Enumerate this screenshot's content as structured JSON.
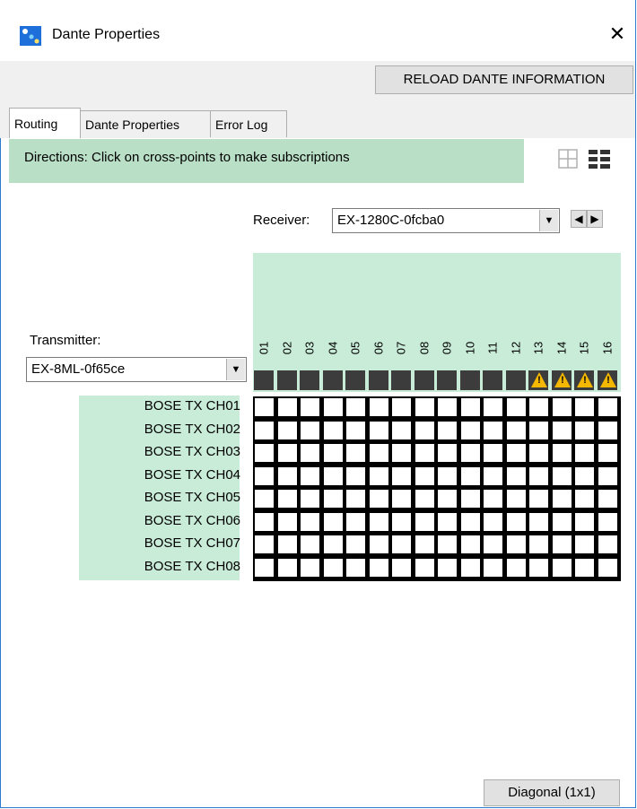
{
  "window": {
    "title": "Dante Properties",
    "close_glyph": "✕"
  },
  "toolbar": {
    "reload_label": "RELOAD DANTE INFORMATION"
  },
  "tabs": [
    {
      "label": "Routing",
      "active": true
    },
    {
      "label": "Dante Properties",
      "active": false
    },
    {
      "label": "Error Log",
      "active": false
    }
  ],
  "routing": {
    "directions": "Directions: Click on cross-points to make subscriptions",
    "view_icons": [
      "grid-view-icon",
      "list-view-icon"
    ],
    "receiver_label": "Receiver:",
    "receiver_value": "EX-1280C-0fcba0",
    "transmitter_label": "Transmitter:",
    "transmitter_value": "EX-8ML-0f65ce",
    "receiver_channels": [
      "01",
      "02",
      "03",
      "04",
      "05",
      "06",
      "07",
      "08",
      "09",
      "10",
      "11",
      "12",
      "13",
      "14",
      "15",
      "16"
    ],
    "channel_warnings": [
      false,
      false,
      false,
      false,
      false,
      false,
      false,
      false,
      false,
      false,
      false,
      false,
      true,
      true,
      true,
      true
    ],
    "transmitter_channels": [
      "BOSE TX CH01",
      "BOSE TX CH02",
      "BOSE TX CH03",
      "BOSE TX CH04",
      "BOSE TX CH05",
      "BOSE TX CH06",
      "BOSE TX CH07",
      "BOSE TX CH08"
    ],
    "warning_mark": "!"
  },
  "footer": {
    "diagonal_label": "Diagonal (1x1)"
  },
  "colors": {
    "accent_green": "#b9dfc6",
    "header_green": "#c9ecd8",
    "warning": "#f5b800",
    "status_dark": "#3c3c3c"
  }
}
